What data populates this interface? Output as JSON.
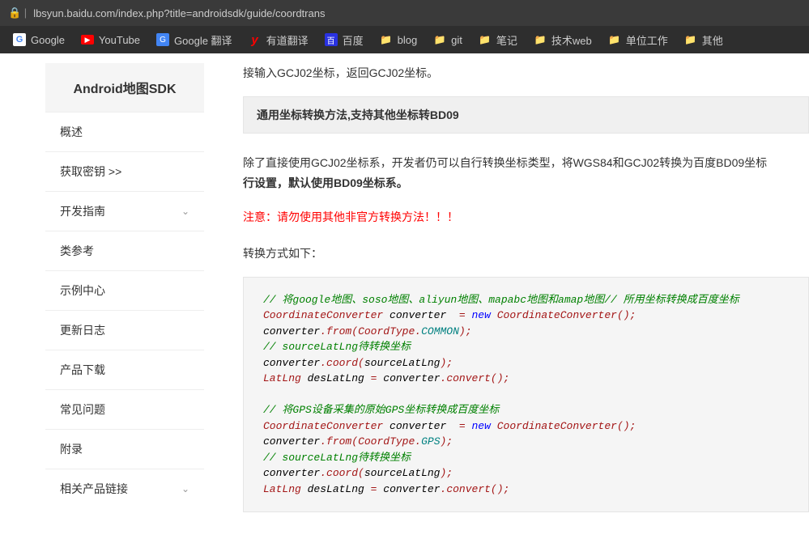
{
  "browser": {
    "url": "lbsyun.baidu.com/index.php?title=androidsdk/guide/coordtrans",
    "bookmarks": [
      {
        "icon": "google",
        "label": "Google"
      },
      {
        "icon": "youtube",
        "label": "YouTube"
      },
      {
        "icon": "gtranslate",
        "label": "Google 翻译"
      },
      {
        "icon": "youdao",
        "label": "有道翻译"
      },
      {
        "icon": "baidu",
        "label": "百度"
      },
      {
        "icon": "folder",
        "label": "blog"
      },
      {
        "icon": "folder",
        "label": "git"
      },
      {
        "icon": "folder",
        "label": "笔记"
      },
      {
        "icon": "folder",
        "label": "技术web"
      },
      {
        "icon": "folder",
        "label": "单位工作"
      },
      {
        "icon": "folder",
        "label": "其他"
      }
    ]
  },
  "sidebar": {
    "title": "Android地图SDK",
    "items": [
      {
        "label": "概述",
        "expandable": false
      },
      {
        "label": "获取密钥 >>",
        "expandable": false
      },
      {
        "label": "开发指南",
        "expandable": true
      },
      {
        "label": "类参考",
        "expandable": false
      },
      {
        "label": "示例中心",
        "expandable": false
      },
      {
        "label": "更新日志",
        "expandable": false
      },
      {
        "label": "产品下载",
        "expandable": false
      },
      {
        "label": "常见问题",
        "expandable": false
      },
      {
        "label": "附录",
        "expandable": false
      },
      {
        "label": "相关产品链接",
        "expandable": true
      }
    ]
  },
  "content": {
    "intro_tail": "接输入GCJ02坐标，返回GCJ02坐标。",
    "section_header": "通用坐标转换方法,支持其他坐标转BD09",
    "para1_a": "除了直接使用GCJ02坐标系，开发者仍可以自行转换坐标类型，将WGS84和GCJ02转换为百度BD09坐标",
    "para1_b": "行设置，默认使用BD09坐标系。",
    "warning": "注意：请勿使用其他非官方转换方法！！！",
    "para2": "转换方式如下：",
    "code": {
      "c1": "// 将google地图、soso地图、aliyun地图、mapabc地图和amap地图// 所用坐标转换成百度坐标",
      "l2a": "CoordinateConverter",
      "l2b": "converter",
      "l2c": "=",
      "l2d": "new",
      "l2e": "CoordinateConverter",
      "l2f": "();",
      "l3a": "converter",
      "l3b": ".",
      "l3c": "from",
      "l3d": "(",
      "l3e": "CoordType",
      "l3f": ".",
      "l3g": "COMMON",
      "l3h": ");",
      "c4": "// sourceLatLng待转换坐标",
      "l5a": "converter",
      "l5b": ".",
      "l5c": "coord",
      "l5d": "(",
      "l5e": "sourceLatLng",
      "l5f": ");",
      "l6a": "LatLng",
      "l6b": "desLatLng",
      "l6c": "=",
      "l6d": "converter",
      "l6e": ".",
      "l6f": "convert",
      "l6g": "();",
      "c7": "// 将GPS设备采集的原始GPS坐标转换成百度坐标",
      "l8a": "CoordinateConverter",
      "l8b": "converter",
      "l8c": "=",
      "l8d": "new",
      "l8e": "CoordinateConverter",
      "l8f": "();",
      "l9a": "converter",
      "l9b": ".",
      "l9c": "from",
      "l9d": "(",
      "l9e": "CoordType",
      "l9f": ".",
      "l9g": "GPS",
      "l9h": ");",
      "c10": "// sourceLatLng待转换坐标",
      "l11a": "converter",
      "l11b": ".",
      "l11c": "coord",
      "l11d": "(",
      "l11e": "sourceLatLng",
      "l11f": ");",
      "l12a": "LatLng",
      "l12b": "desLatLng",
      "l12c": "=",
      "l12d": "converter",
      "l12e": ".",
      "l12f": "convert",
      "l12g": "();"
    }
  }
}
